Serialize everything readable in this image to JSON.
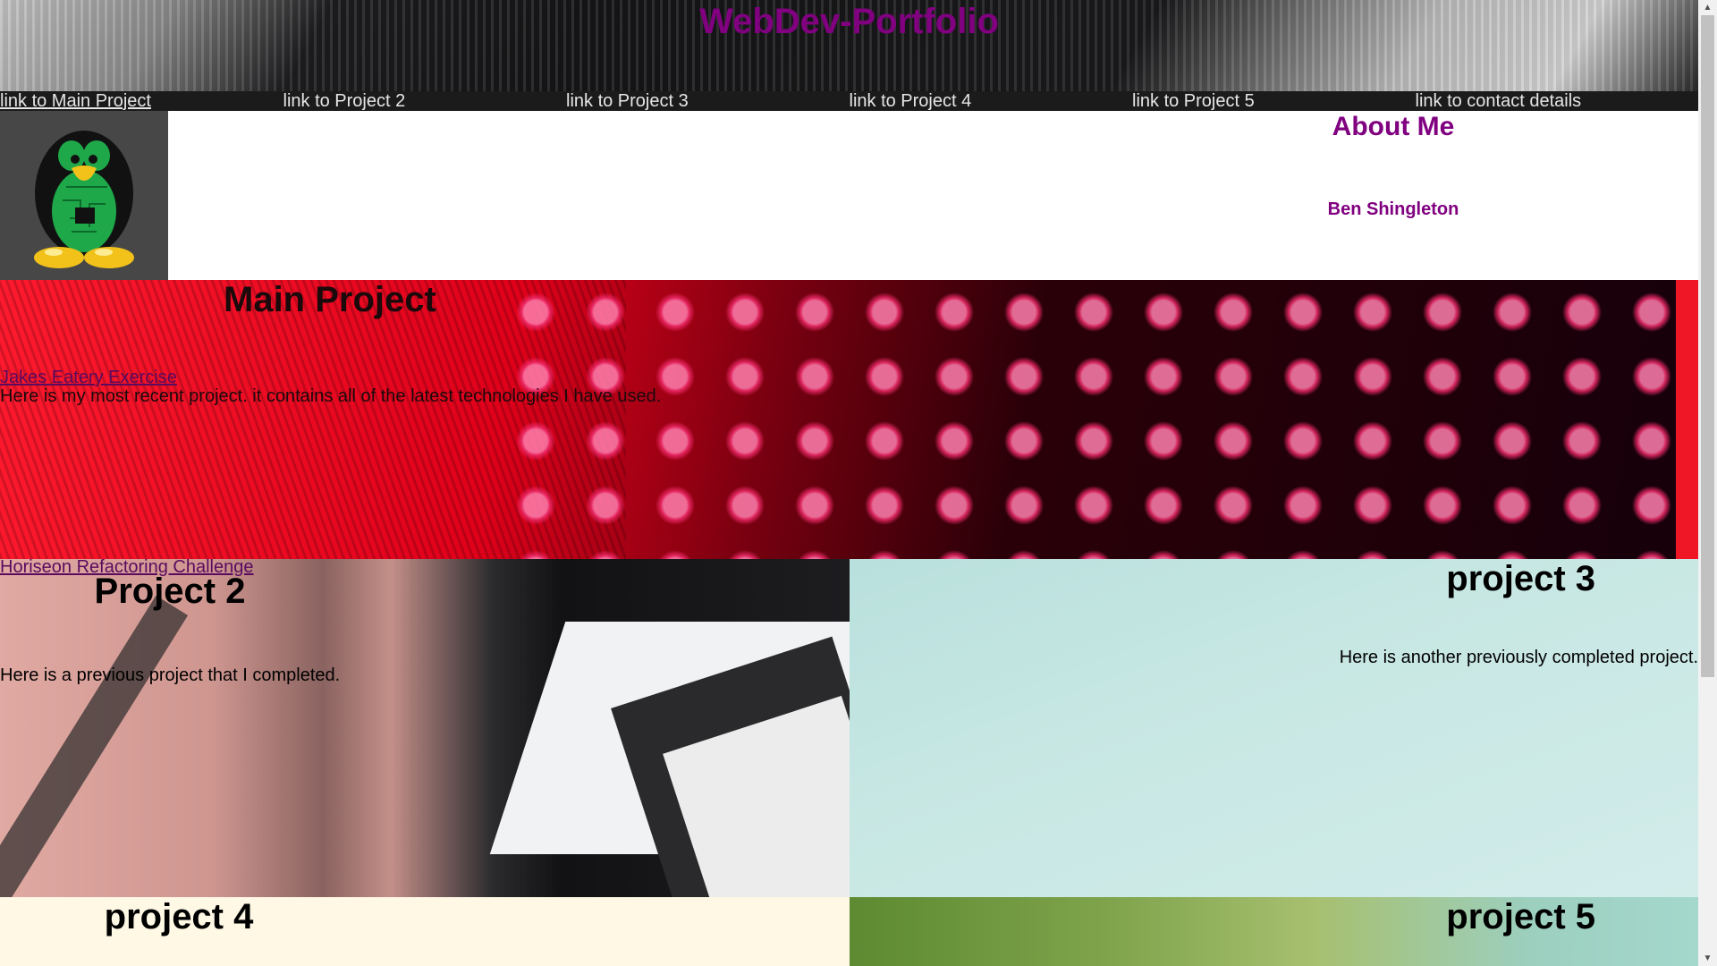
{
  "header": {
    "title": "WebDev-Portfolio",
    "nav": [
      {
        "label": "link to Main Project"
      },
      {
        "label": "link to Project 2"
      },
      {
        "label": "link to Project 3"
      },
      {
        "label": "link to Project 4"
      },
      {
        "label": "link to Project 5"
      },
      {
        "label": "link to contact details"
      }
    ]
  },
  "about": {
    "title": "About Me",
    "name": "Ben Shingleton",
    "avatar_icon": "tux-penguin-icon"
  },
  "main_project": {
    "title": "Main Project",
    "link": "Jakes Eatery Exercise",
    "description": "Here is my most recent project. it contains all of the latest technologies I have used."
  },
  "project2": {
    "link": "Horiseon Refactoring Challenge",
    "title": "Project 2",
    "description": "Here is a previous project that I completed."
  },
  "project3": {
    "title": "project 3",
    "description": "Here is another previously completed project."
  },
  "project4": {
    "title": "project 4"
  },
  "project5": {
    "title": "project 5"
  },
  "colors": {
    "title_purple": "#800080",
    "nav_bar": "#1b1b1b",
    "main_red": "#e0001a",
    "project3_bg": "#c7e7e3",
    "project4_bg": "#fff8e5"
  },
  "scrollbar": {
    "up_icon": "scroll-up-arrow-icon",
    "down_icon": "scroll-down-arrow-icon"
  }
}
